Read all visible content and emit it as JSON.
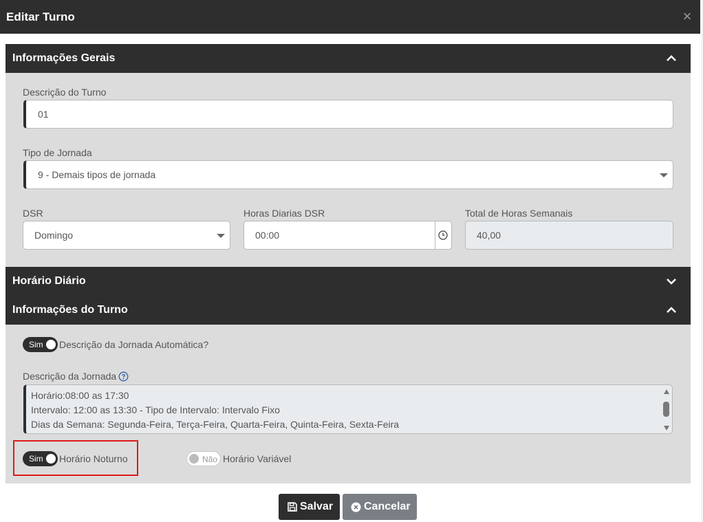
{
  "modal": {
    "title": "Editar Turno",
    "close_glyph": "×"
  },
  "sections": {
    "gerais": {
      "title": "Informações Gerais"
    },
    "horario": {
      "title": "Horário Diário"
    },
    "turno": {
      "title": "Informações do Turno"
    }
  },
  "form": {
    "descricao_label": "Descrição do Turno",
    "descricao_value": "01",
    "tipo_label": "Tipo de Jornada",
    "tipo_value": "9 - Demais tipos de jornada",
    "dsr_label": "DSR",
    "dsr_value": "Domingo",
    "horas_dsr_label": "Horas Diarias DSR",
    "horas_dsr_value": "00:00",
    "total_label": "Total de Horas Semanais",
    "total_value": "40,00"
  },
  "turno": {
    "auto_toggle_label": "Sim",
    "auto_label": "Descrição da Jornada Automática?",
    "jornada_label": "Descrição da Jornada",
    "jornada_lines": [
      "Horário:08:00 as 17:30",
      "Intervalo: 12:00 as 13:30 - Tipo de Intervalo: Intervalo Fixo",
      "Dias da Semana: Segunda-Feira, Terça-Feira, Quarta-Feira, Quinta-Feira, Sexta-Feira"
    ],
    "noturno_toggle_label": "Sim",
    "noturno_label": "Horário Noturno",
    "variavel_toggle_label": "Não",
    "variavel_label": "Horário Variável"
  },
  "buttons": {
    "save": "Salvar",
    "cancel": "Cancelar"
  },
  "icons": {
    "chevron_up": "chevron-up-icon",
    "chevron_down": "chevron-down-icon",
    "clock": "clock-icon",
    "help": "help-circle-icon",
    "save": "floppy-disk-icon",
    "cancel": "x-circle-icon",
    "close": "close-icon"
  },
  "colors": {
    "header": "#2e2e2e",
    "body": "#dcdcdc",
    "highlight": "#e01818",
    "cancel": "#7a7f85"
  }
}
